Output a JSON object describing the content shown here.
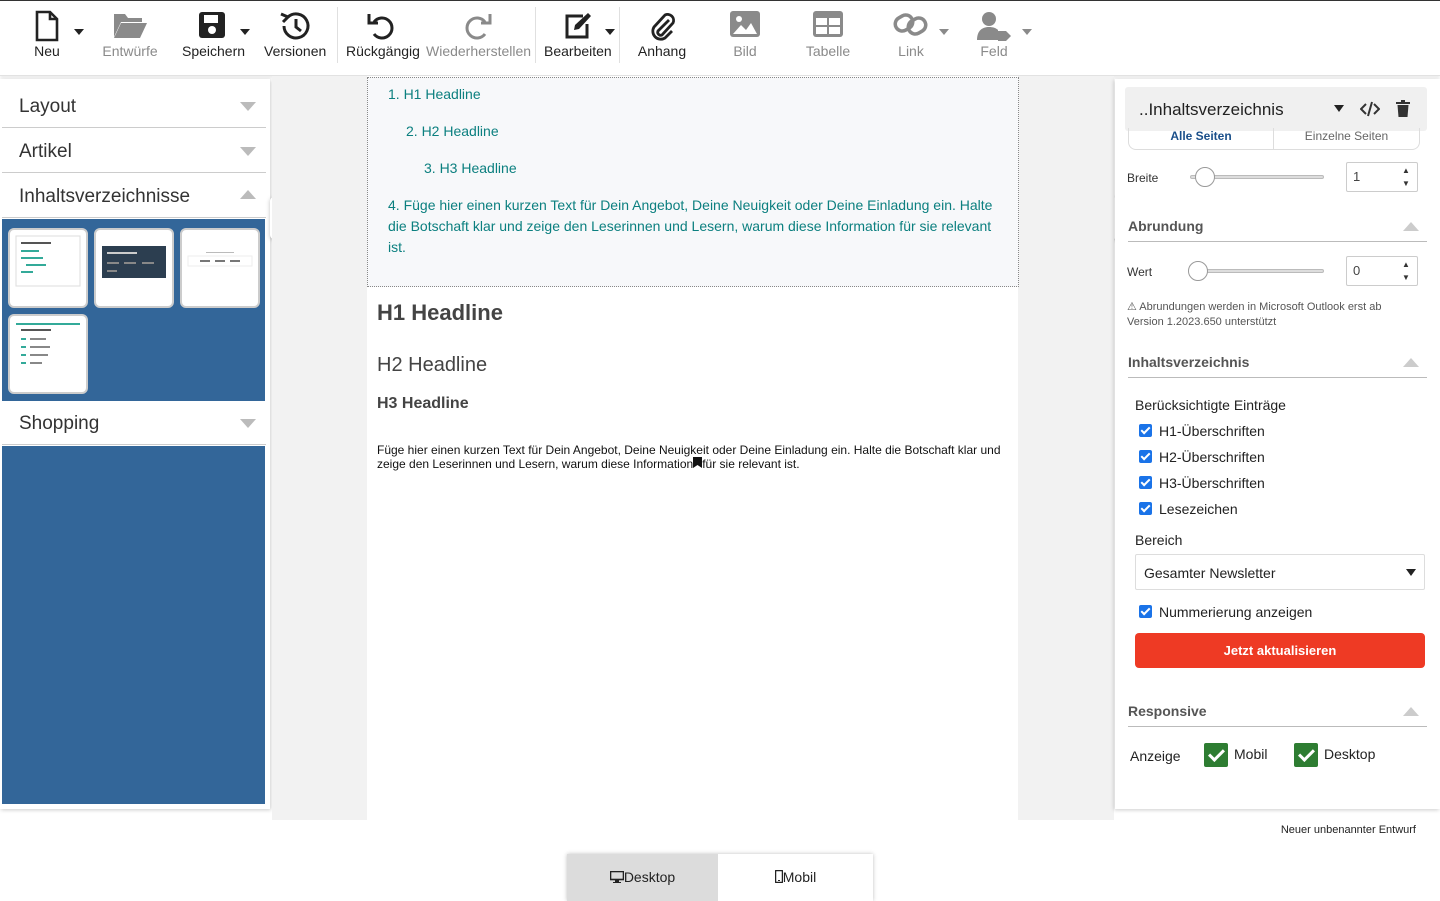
{
  "toolbar": {
    "new": "Neu",
    "drafts": "Entwürfe",
    "save": "Speichern",
    "versions": "Versionen",
    "undo": "Rückgängig",
    "redo": "Wiederherstellen",
    "edit": "Bearbeiten",
    "attachment": "Anhang",
    "image": "Bild",
    "table": "Tabelle",
    "link": "Link",
    "field": "Feld"
  },
  "left_panel": {
    "sections": [
      "Layout",
      "Artikel",
      "Inhaltsverzeichnisse",
      "Shopping"
    ]
  },
  "document": {
    "toc": [
      "1. H1 Headline",
      "2. H2 Headline",
      "3. H3 Headline",
      "4. Füge hier einen kurzen Text für Dein Angebot, Deine Neuigkeit oder Deine Einladung ein. Halte die Botschaft klar und zeige den Leserinnen und Lesern, warum diese Information für sie relevant ist."
    ],
    "h1": "H1 Headline",
    "h2": "H2 Headline",
    "h3": "H3 Headline",
    "paragraph_before": "Füge hier einen kurzen Text für Dein Angebot, Deine Neuigkeit oder Deine Einladung ein. Halte die Botschaft klar und zeige den Leserinnen und Lesern, warum diese Information",
    "paragraph_after": "für sie relevant ist."
  },
  "right_panel": {
    "block_title": "..Inhaltsverzeichnis",
    "seg_all": "Alle Seiten",
    "seg_single": "Einzelne Seiten",
    "width_label": "Breite",
    "width_value": "1",
    "rounding_title": "Abrundung",
    "rounding_label": "Wert",
    "rounding_value": "0",
    "rounding_note": "⚠ Abrundungen werden in Microsoft Outlook erst ab Version 1.2023.650 unterstützt",
    "toc_title": "Inhaltsverzeichnis",
    "entries_label": "Berücksichtigte Einträge",
    "entries": [
      "H1-Überschriften",
      "H2-Überschriften",
      "H3-Überschriften",
      "Lesezeichen"
    ],
    "area_label": "Bereich",
    "area_value": "Gesamter Newsletter",
    "numbering": "Nummerierung anzeigen",
    "update_button": "Jetzt aktualisieren",
    "responsive_title": "Responsive",
    "display_label": "Anzeige",
    "mobile": "Mobil",
    "desktop": "Desktop"
  },
  "status": "Neuer unbenannter Entwurf",
  "view_tabs": {
    "desktop": "Desktop",
    "mobile": "Mobil"
  },
  "colors": {
    "accent_blue": "#336699",
    "toc_teal": "#0b7f7f",
    "button_red": "#ee3a24",
    "check_green": "#2e7d32"
  }
}
